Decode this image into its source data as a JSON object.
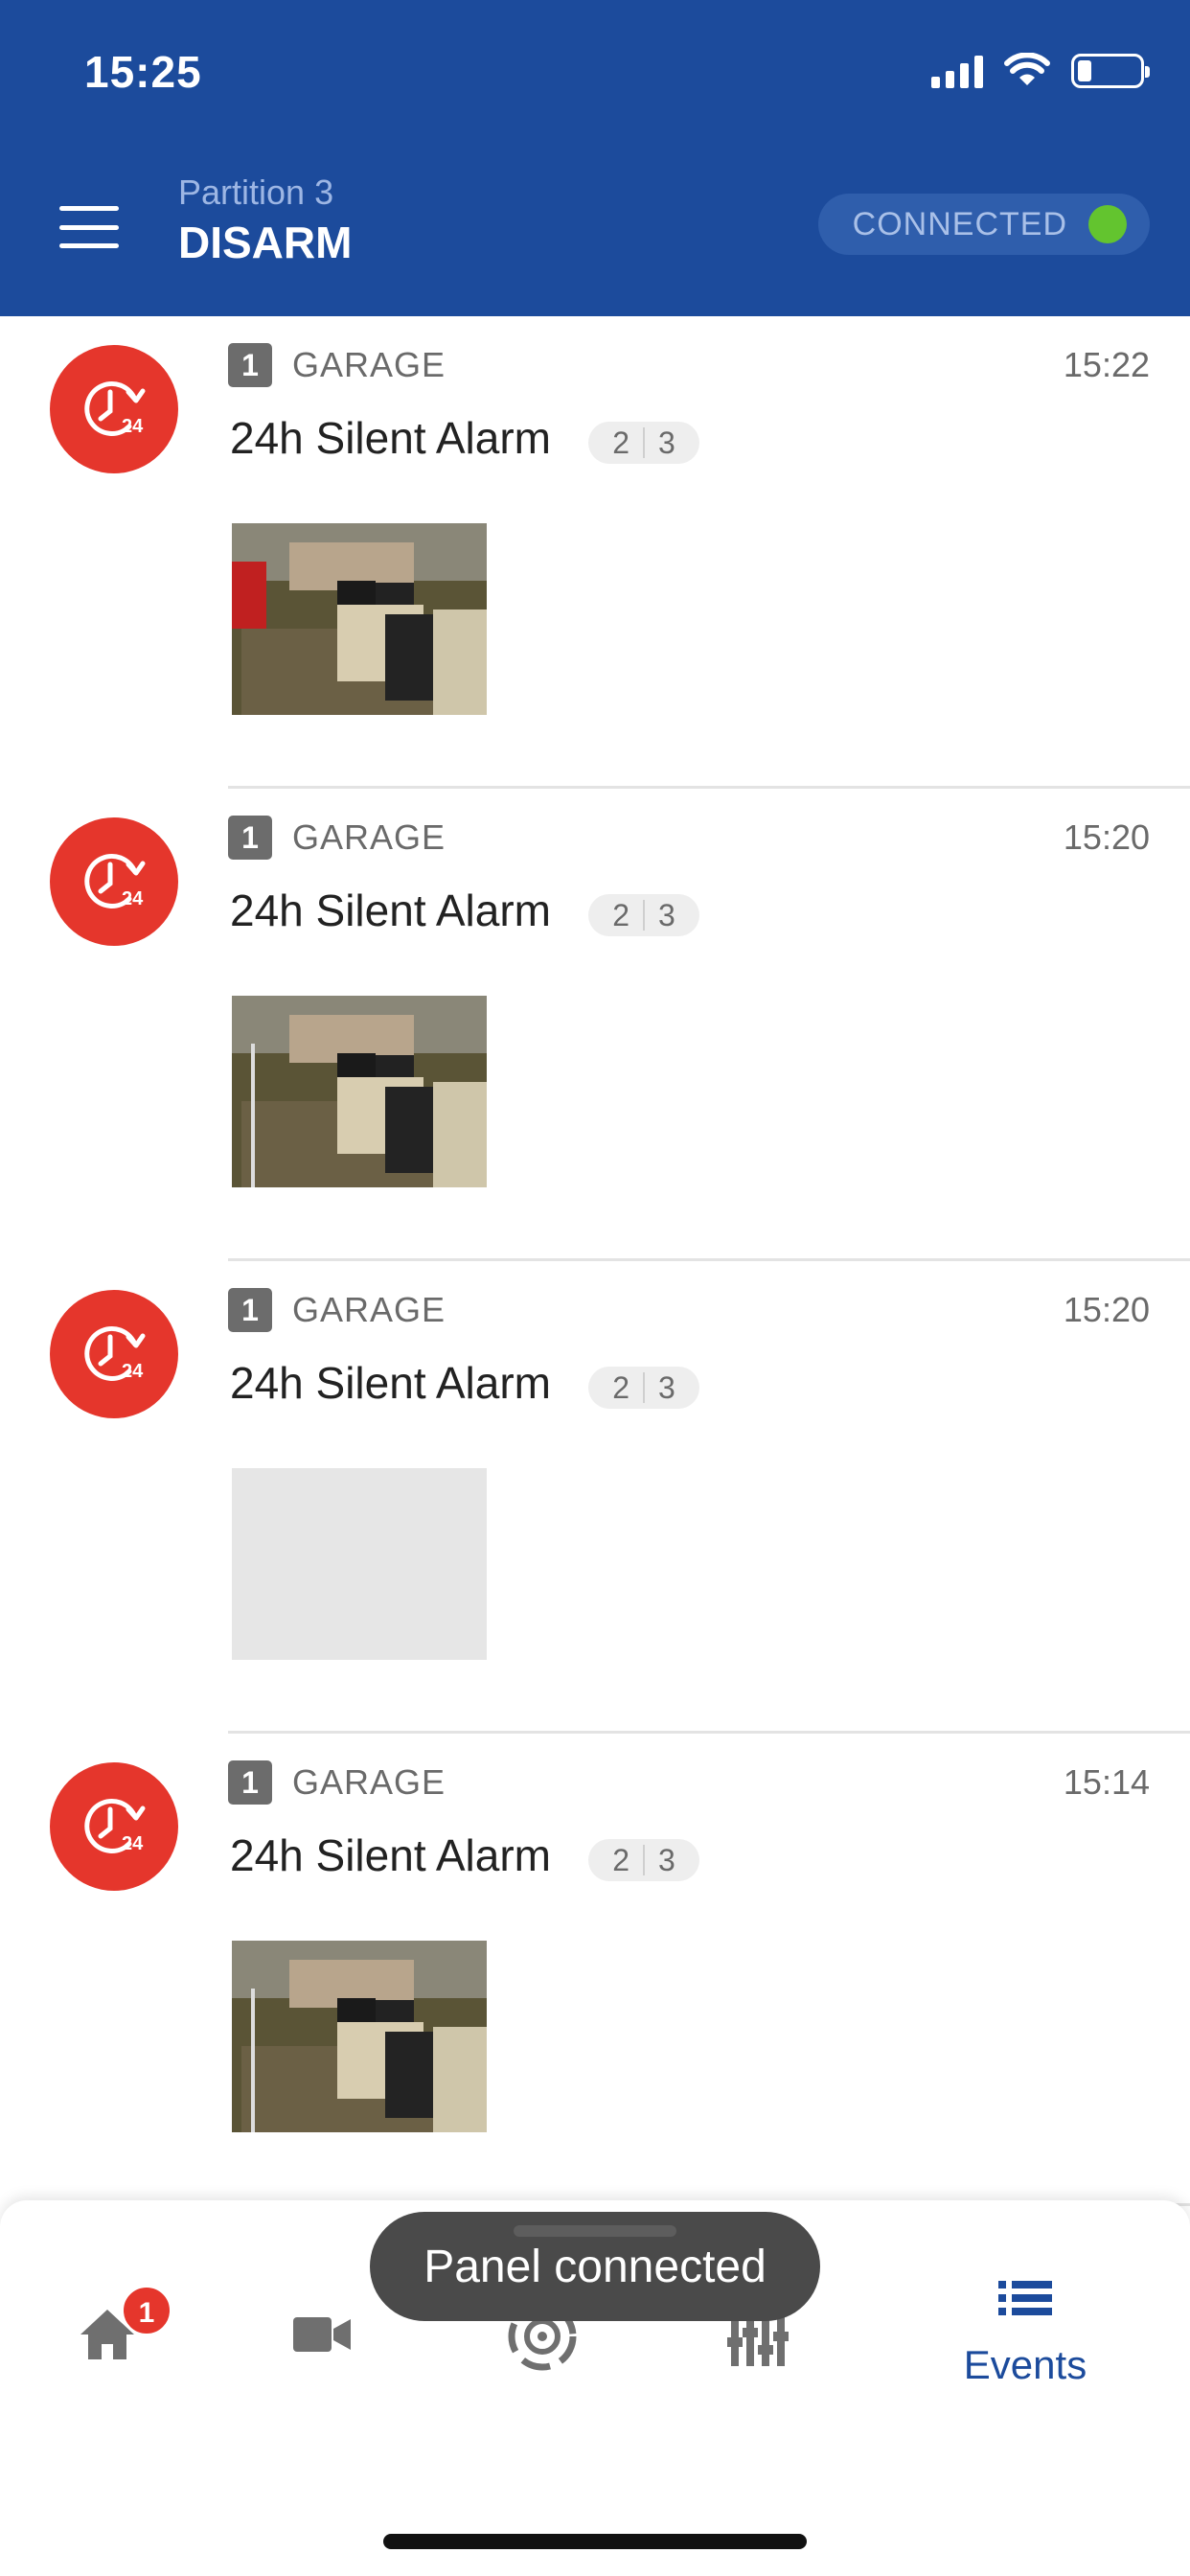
{
  "status_bar": {
    "time": "15:25"
  },
  "header": {
    "partition_label": "Partition 3",
    "partition_state": "DISARM",
    "connection_status": "CONNECTED",
    "connection_color": "#63c42f",
    "brand_color": "#1c4b9c"
  },
  "events": [
    {
      "zone_number": "1",
      "zone_name": "GARAGE",
      "time": "15:22",
      "title": "24h Silent Alarm",
      "cameras": [
        "2",
        "3"
      ],
      "has_image": true,
      "icon": "24h-alarm-icon"
    },
    {
      "zone_number": "1",
      "zone_name": "GARAGE",
      "time": "15:20",
      "title": "24h Silent Alarm",
      "cameras": [
        "2",
        "3"
      ],
      "has_image": true,
      "icon": "24h-alarm-icon"
    },
    {
      "zone_number": "1",
      "zone_name": "GARAGE",
      "time": "15:20",
      "title": "24h Silent Alarm",
      "cameras": [
        "2",
        "3"
      ],
      "has_image": false,
      "icon": "24h-alarm-icon"
    },
    {
      "zone_number": "1",
      "zone_name": "GARAGE",
      "time": "15:14",
      "title": "24h Silent Alarm",
      "cameras": [
        "2",
        "3"
      ],
      "has_image": true,
      "icon": "24h-alarm-icon"
    }
  ],
  "bottom_nav": {
    "home_badge": "1",
    "items": [
      {
        "icon": "home-icon"
      },
      {
        "icon": "camera-icon"
      },
      {
        "icon": "arm-icon"
      },
      {
        "icon": "automation-icon"
      },
      {
        "icon": "events-list-icon",
        "label": "Events",
        "active": true
      }
    ]
  },
  "toast": {
    "message": "Panel connected"
  }
}
